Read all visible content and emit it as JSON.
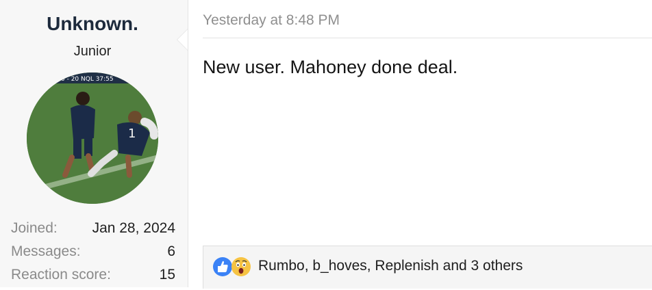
{
  "user": {
    "name": "Unknown.",
    "title": "Junior",
    "stats": [
      {
        "label": "Joined:",
        "value": "Jan 28, 2024"
      },
      {
        "label": "Messages:",
        "value": "6"
      },
      {
        "label": "Reaction score:",
        "value": "15"
      }
    ],
    "avatar_scoreboard": "0 - 20 NQL 37:55"
  },
  "post": {
    "timestamp": "Yesterday at 8:48 PM",
    "body": "New user. Mahoney done deal."
  },
  "reactions": {
    "icons": [
      "like-icon",
      "wow-icon"
    ],
    "summary": "Rumbo, b_hoves, Replenish and 3 others"
  },
  "colors": {
    "username": "#1d2a3c",
    "like": "#3b82f6",
    "wow": "#f6c343"
  }
}
